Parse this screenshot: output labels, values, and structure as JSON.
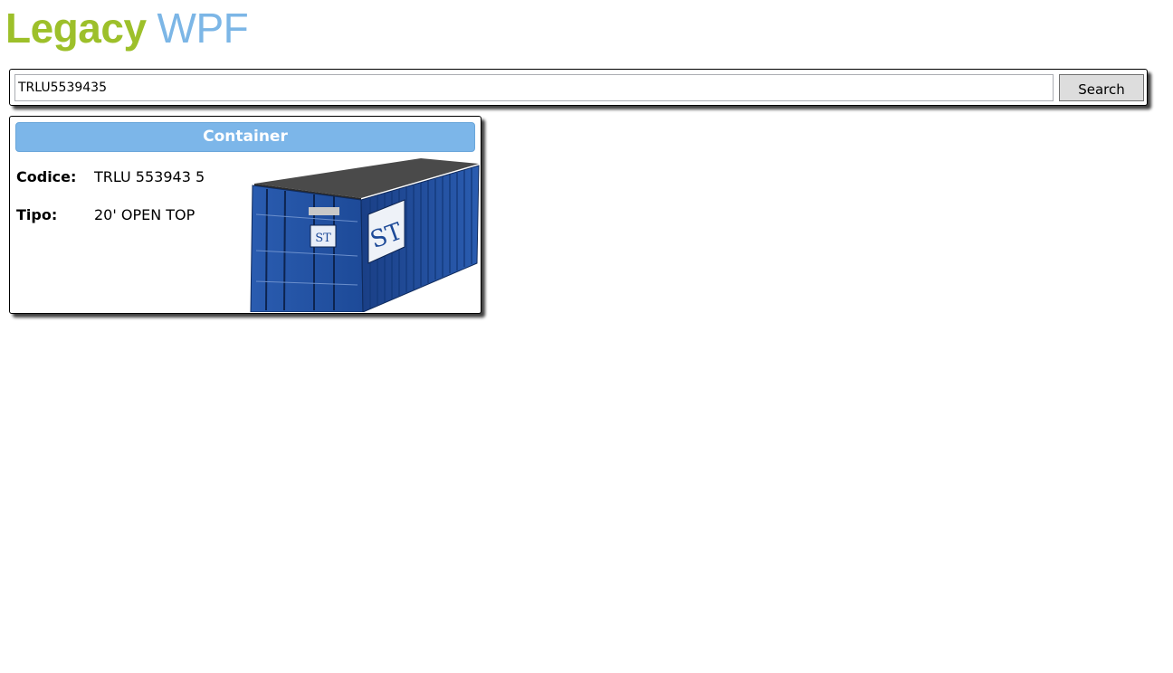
{
  "app": {
    "title_part1": "Legacy",
    "title_part2": "WPF"
  },
  "search": {
    "value": "TRLU5539435",
    "button_label": "Search"
  },
  "card": {
    "header": "Container",
    "fields": [
      {
        "label": "Codice:",
        "value": "TRLU 553943 5"
      },
      {
        "label": "Tipo:",
        "value": "20' OPEN TOP"
      }
    ],
    "image": {
      "icon": "shipping-container-icon",
      "logo_text": "ST"
    }
  },
  "colors": {
    "title_green": "#9dc02a",
    "title_blue": "#7cb6e6",
    "header_blue": "#7cb6e9",
    "container_blue": "#1f4f9e"
  }
}
